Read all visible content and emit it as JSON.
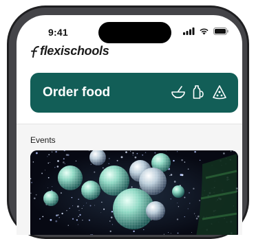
{
  "status_bar": {
    "time": "9:41",
    "icons": [
      "signal-icon",
      "wifi-icon",
      "battery-icon"
    ]
  },
  "brand": {
    "name": "flexischools",
    "color": "#125e57"
  },
  "order_card": {
    "title": "Order food",
    "icons": [
      "bowl-icon",
      "drink-icon",
      "pizza-icon"
    ]
  },
  "events": {
    "heading": "Events",
    "image_name": "disco-balls-photo"
  }
}
